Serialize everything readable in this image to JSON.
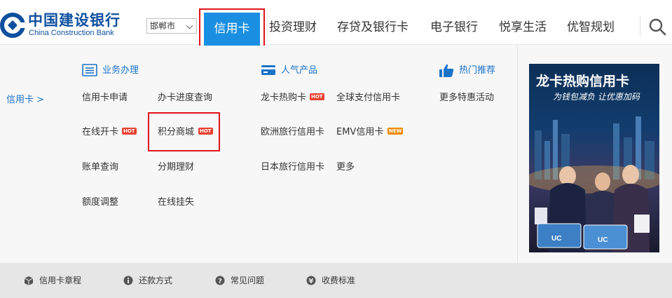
{
  "header": {
    "logo_cn": "中国建设银行",
    "logo_en": "China Construction Bank",
    "city": "邯郸市",
    "nav": [
      {
        "label": "信用卡"
      },
      {
        "label": "投资理财"
      },
      {
        "label": "存贷及银行卡"
      },
      {
        "label": "电子银行"
      },
      {
        "label": "悦享生活"
      },
      {
        "label": "优智规划"
      }
    ]
  },
  "panel": {
    "side_link": "信用卡 >",
    "business": {
      "title": "业务办理",
      "items": [
        "信用卡申请",
        "办卡进度查询",
        "在线开卡",
        "积分商城",
        "账单查询",
        "分期理财",
        "额度调整",
        "在线挂失"
      ]
    },
    "popular": {
      "title": "人气产品",
      "items": [
        "龙卡热购卡",
        "全球支付信用卡",
        "欧洲旅行信用卡",
        "EMV信用卡",
        "日本旅行信用卡",
        "更多"
      ]
    },
    "hot": {
      "title": "热门推荐",
      "items": [
        "更多特惠活动"
      ]
    },
    "badges": {
      "hot": "HOT",
      "new": "NEW"
    },
    "promo": {
      "title": "龙卡热购信用卡",
      "subtitle": "为钱包减负  让优惠加码"
    }
  },
  "footer": {
    "items": [
      "信用卡章程",
      "还款方式",
      "常见问题",
      "收费标准"
    ]
  },
  "colors": {
    "brand": "#0d4f9e",
    "active_nav": "#1a8fe2",
    "link": "#1a73c9",
    "highlight": "#e0141b",
    "hot_badge": "#e8412f",
    "new_badge": "#f08a00"
  }
}
